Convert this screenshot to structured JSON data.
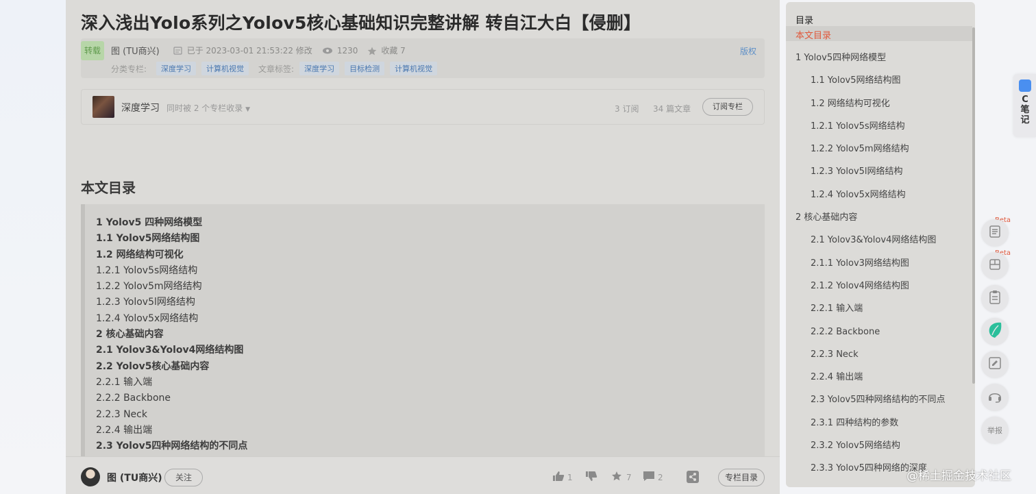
{
  "article": {
    "title": "深入浅出Yolo系列之Yolov5核心基础知识完整讲解 转自江大白【侵删】",
    "badge": "转载",
    "author": "图 (TU商兴)",
    "modified": "已于 2023-03-01 21:53:22 修改",
    "views": "1230",
    "favorites": "收藏 7",
    "copyright": "版权",
    "category_label": "分类专栏:",
    "categories": [
      "深度学习",
      "计算机视觉"
    ],
    "tag_label": "文章标签:",
    "tags": [
      "深度学习",
      "目标检测",
      "计算机视觉"
    ]
  },
  "column": {
    "name": "深度学习",
    "included": "同时被 2 个专栏收录",
    "subscriptions": "3 订阅",
    "articles": "34 篇文章",
    "subscribe_label": "订阅专栏"
  },
  "toc": {
    "heading": "本文目录",
    "items": [
      {
        "text": "1 Yolov5 四种网络模型",
        "bold": true
      },
      {
        "text": "1.1 Yolov5网络结构图",
        "bold": true
      },
      {
        "text": "1.2 网络结构可视化",
        "bold": true
      },
      {
        "text": "1.2.1 Yolov5s网络结构",
        "bold": false
      },
      {
        "text": "1.2.2 Yolov5m网络结构",
        "bold": false
      },
      {
        "text": "1.2.3 Yolov5l网络结构",
        "bold": false
      },
      {
        "text": "1.2.4 Yolov5x网络结构",
        "bold": false
      },
      {
        "text": "2 核心基础内容",
        "bold": true
      },
      {
        "text": "2.1 Yolov3&Yolov4网络结构图",
        "bold": true
      },
      {
        "text": "2.2 Yolov5核心基础内容",
        "bold": true
      },
      {
        "text": "2.2.1 输入端",
        "bold": false
      },
      {
        "text": "2.2.2 Backbone",
        "bold": false
      },
      {
        "text": "2.2.3 Neck",
        "bold": false
      },
      {
        "text": "2.2.4 输出端",
        "bold": false
      },
      {
        "text": "2.3 Yolov5四种网络结构的不同点",
        "bold": true
      }
    ]
  },
  "bottom_bar": {
    "author": "图 (TU商兴)",
    "follow_label": "关注",
    "likes": "1",
    "stars": "7",
    "comments": "2",
    "column_toc_label": "专栏目录"
  },
  "sidebar": {
    "title": "目录",
    "active": "本文目录",
    "items": [
      {
        "text": "1 Yolov5四种网络模型",
        "level": 1
      },
      {
        "text": "1.1 Yolov5网络结构图",
        "level": 2
      },
      {
        "text": "1.2 网络结构可视化",
        "level": 2
      },
      {
        "text": "1.2.1 Yolov5s网络结构",
        "level": 2
      },
      {
        "text": "1.2.2 Yolov5m网络结构",
        "level": 2
      },
      {
        "text": "1.2.3 Yolov5l网络结构",
        "level": 2
      },
      {
        "text": "1.2.4 Yolov5x网络结构",
        "level": 2
      },
      {
        "text": "2 核心基础内容",
        "level": 1
      },
      {
        "text": "2.1 Yolov3&Yolov4网络结构图",
        "level": 2
      },
      {
        "text": "2.1.1 Yolov3网络结构图",
        "level": 2
      },
      {
        "text": "2.1.2 Yolov4网络结构图",
        "level": 2
      },
      {
        "text": "2.2.1 输入端",
        "level": 2
      },
      {
        "text": "2.2.2 Backbone",
        "level": 2
      },
      {
        "text": "2.2.3 Neck",
        "level": 2
      },
      {
        "text": "2.2.4 输出端",
        "level": 2
      },
      {
        "text": "2.3 Yolov5四种网络结构的不同点",
        "level": 2
      },
      {
        "text": "2.3.1 四种结构的参数",
        "level": 2
      },
      {
        "text": "2.3.2 Yolov5网络结构",
        "level": 2
      },
      {
        "text": "2.3.3 Yolov5四种网络的深度",
        "level": 2
      }
    ]
  },
  "tools": {
    "note_label": "C笔记",
    "beta": "Beta",
    "report": "举报"
  },
  "watermark": "@稀土掘金技术社区",
  "colors": {
    "accent_red": "#e0583b",
    "link_blue": "#5d8fc7",
    "repost_green": "#5f9a4c"
  }
}
